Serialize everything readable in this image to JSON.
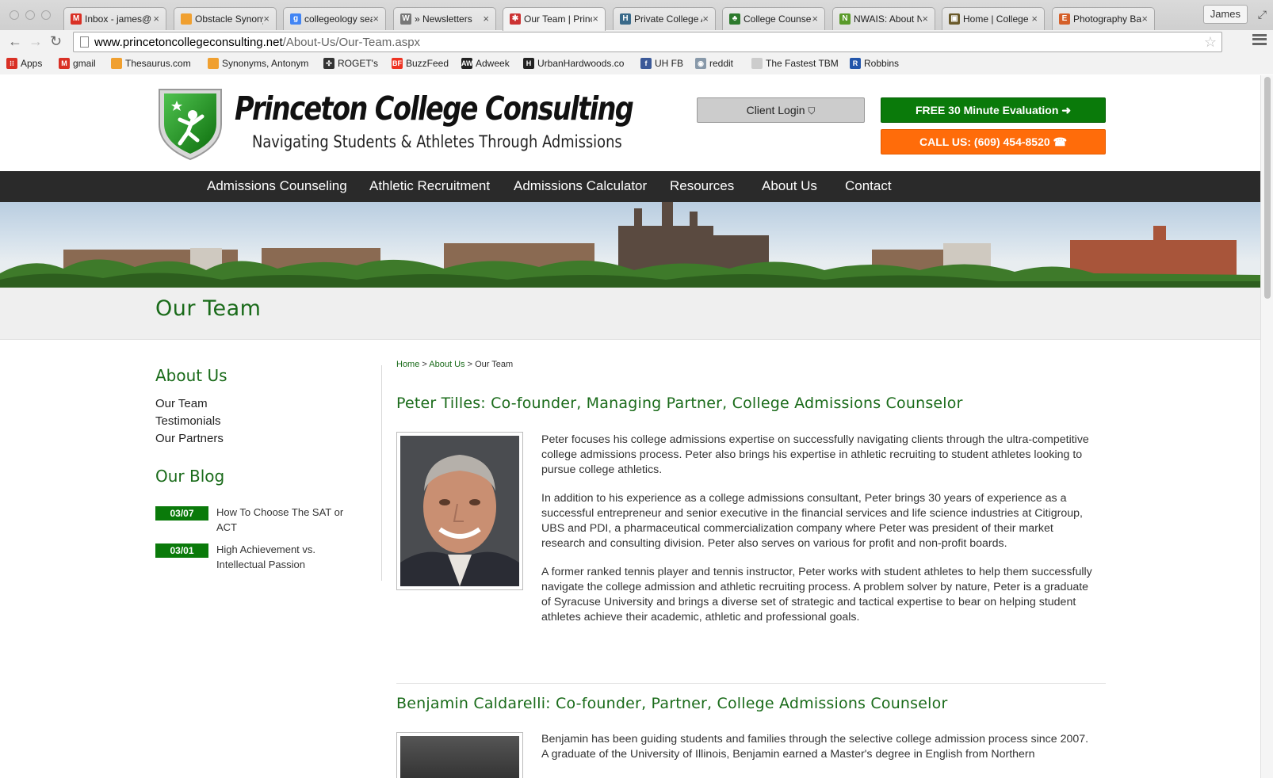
{
  "browser": {
    "tabs": [
      {
        "title": "Inbox - james@",
        "favicon": "gmail-icon",
        "color": "#d93025",
        "glyph": "M"
      },
      {
        "title": "Obstacle Synony",
        "favicon": "thesaurus-icon",
        "color": "#f0a030",
        "glyph": ""
      },
      {
        "title": "collegeology sea",
        "favicon": "google-icon",
        "color": "#4285f4",
        "glyph": "g"
      },
      {
        "title": "» Newsletters",
        "favicon": "wordpress-icon",
        "color": "#777777",
        "glyph": "W"
      },
      {
        "title": "Our Team | Princ",
        "favicon": "pcc-icon",
        "color": "#cc3333",
        "glyph": "✱"
      },
      {
        "title": "Private College A",
        "favicon": "h-icon",
        "color": "#3a6a8a",
        "glyph": "H"
      },
      {
        "title": "College Counsel",
        "favicon": "leaf-icon",
        "color": "#2d7a2d",
        "glyph": "♣"
      },
      {
        "title": "NWAIS: About N",
        "favicon": "n-icon",
        "color": "#5a9a2a",
        "glyph": "N"
      },
      {
        "title": "Home | College",
        "favicon": "crest-icon",
        "color": "#6a5a2a",
        "glyph": "▣"
      },
      {
        "title": "Photography Bac",
        "favicon": "e-icon",
        "color": "#d5602a",
        "glyph": "E"
      }
    ],
    "active_tab": 4,
    "profile_name": "James",
    "url_host": "www.princetoncollegeconsulting.net",
    "url_path": "/About-Us/Our-Team.aspx",
    "bookmarks": [
      {
        "label": "Apps",
        "icon": "apps-grid-icon",
        "color": "#d93025",
        "glyph": "⁝⁝"
      },
      {
        "label": "gmail",
        "icon": "gmail-icon",
        "color": "#d93025",
        "glyph": "M"
      },
      {
        "label": "Thesaurus.com",
        "icon": "thesaurus-icon",
        "color": "#f0a030",
        "glyph": ""
      },
      {
        "label": "Synonyms, Antonym",
        "icon": "thesaurus-icon",
        "color": "#f0a030",
        "glyph": ""
      },
      {
        "label": "ROGET's",
        "icon": "roget-icon",
        "color": "#333333",
        "glyph": "✣"
      },
      {
        "label": "BuzzFeed",
        "icon": "buzzfeed-icon",
        "color": "#ee3322",
        "glyph": "BF"
      },
      {
        "label": "Adweek",
        "icon": "adweek-icon",
        "color": "#222222",
        "glyph": "AW"
      },
      {
        "label": "UrbanHardwoods.co",
        "icon": "urbanhardwoods-icon",
        "color": "#222222",
        "glyph": "H"
      },
      {
        "label": "UH FB",
        "icon": "facebook-icon",
        "color": "#3b5998",
        "glyph": "f"
      },
      {
        "label": "reddit",
        "icon": "reddit-icon",
        "color": "#8899aa",
        "glyph": "◉"
      },
      {
        "label": "The Fastest TBM",
        "icon": "page-icon",
        "color": "#cccccc",
        "glyph": ""
      },
      {
        "label": "Robbins",
        "icon": "robbins-icon",
        "color": "#2255aa",
        "glyph": "R"
      }
    ]
  },
  "site": {
    "logo_title": "Princeton College Consulting",
    "logo_tagline": "Navigating Students & Athletes Through Admissions",
    "login_label": "Client Login",
    "eval_label": "FREE 30 Minute Evaluation",
    "call_label": "CALL US: (609) 454-8520",
    "nav": [
      "Admissions Counseling",
      "Athletic Recruitment",
      "Admissions Calculator",
      "Resources",
      "About Us",
      "Contact"
    ],
    "page_title": "Our Team",
    "brand_green": "#1a6b1a",
    "accent_orange": "#ff6c0a"
  },
  "sidebar": {
    "about_heading": "About Us",
    "links": [
      "Our Team",
      "Testimonials",
      "Our Partners"
    ],
    "blog_heading": "Our Blog",
    "posts": [
      {
        "date": "03/07",
        "title": "How To Choose The SAT or ACT"
      },
      {
        "date": "03/01",
        "title": "High Achievement vs. Intellectual Passion"
      }
    ]
  },
  "content": {
    "breadcrumb": {
      "home": "Home",
      "sep1": " > ",
      "about": "About Us",
      "sep2": " > ",
      "current": "Our Team"
    },
    "team": [
      {
        "name": "Peter Tilles: Co-founder, Managing Partner, College Admissions Counselor",
        "bio": [
          "Peter focuses his college admissions expertise on successfully navigating clients through the ultra-competitive college admissions process. Peter also brings his expertise in athletic recruiting to student athletes looking to pursue college athletics.",
          "In addition to his experience as a college admissions consultant, Peter brings 30 years of experience as a successful entrepreneur and senior executive in the financial services and life science industries at Citigroup, UBS and PDI, a pharmaceutical commercialization company where Peter was president of their market research and consulting division. Peter also serves on various for profit and non-profit boards.",
          "A former ranked tennis player and tennis instructor, Peter works with student athletes to help them successfully navigate the college admission and athletic recruiting process. A problem solver by nature, Peter is a graduate of Syracuse University and brings a diverse set of strategic and tactical expertise to bear on helping student athletes achieve their academic, athletic and professional goals."
        ]
      },
      {
        "name": "Benjamin Caldarelli: Co-founder, Partner, College Admissions Counselor",
        "bio": [
          "Benjamin has been guiding students and families through the selective college admission process since 2007. A graduate of the University of Illinois, Benjamin earned a Master's degree in English from Northern"
        ]
      }
    ]
  }
}
